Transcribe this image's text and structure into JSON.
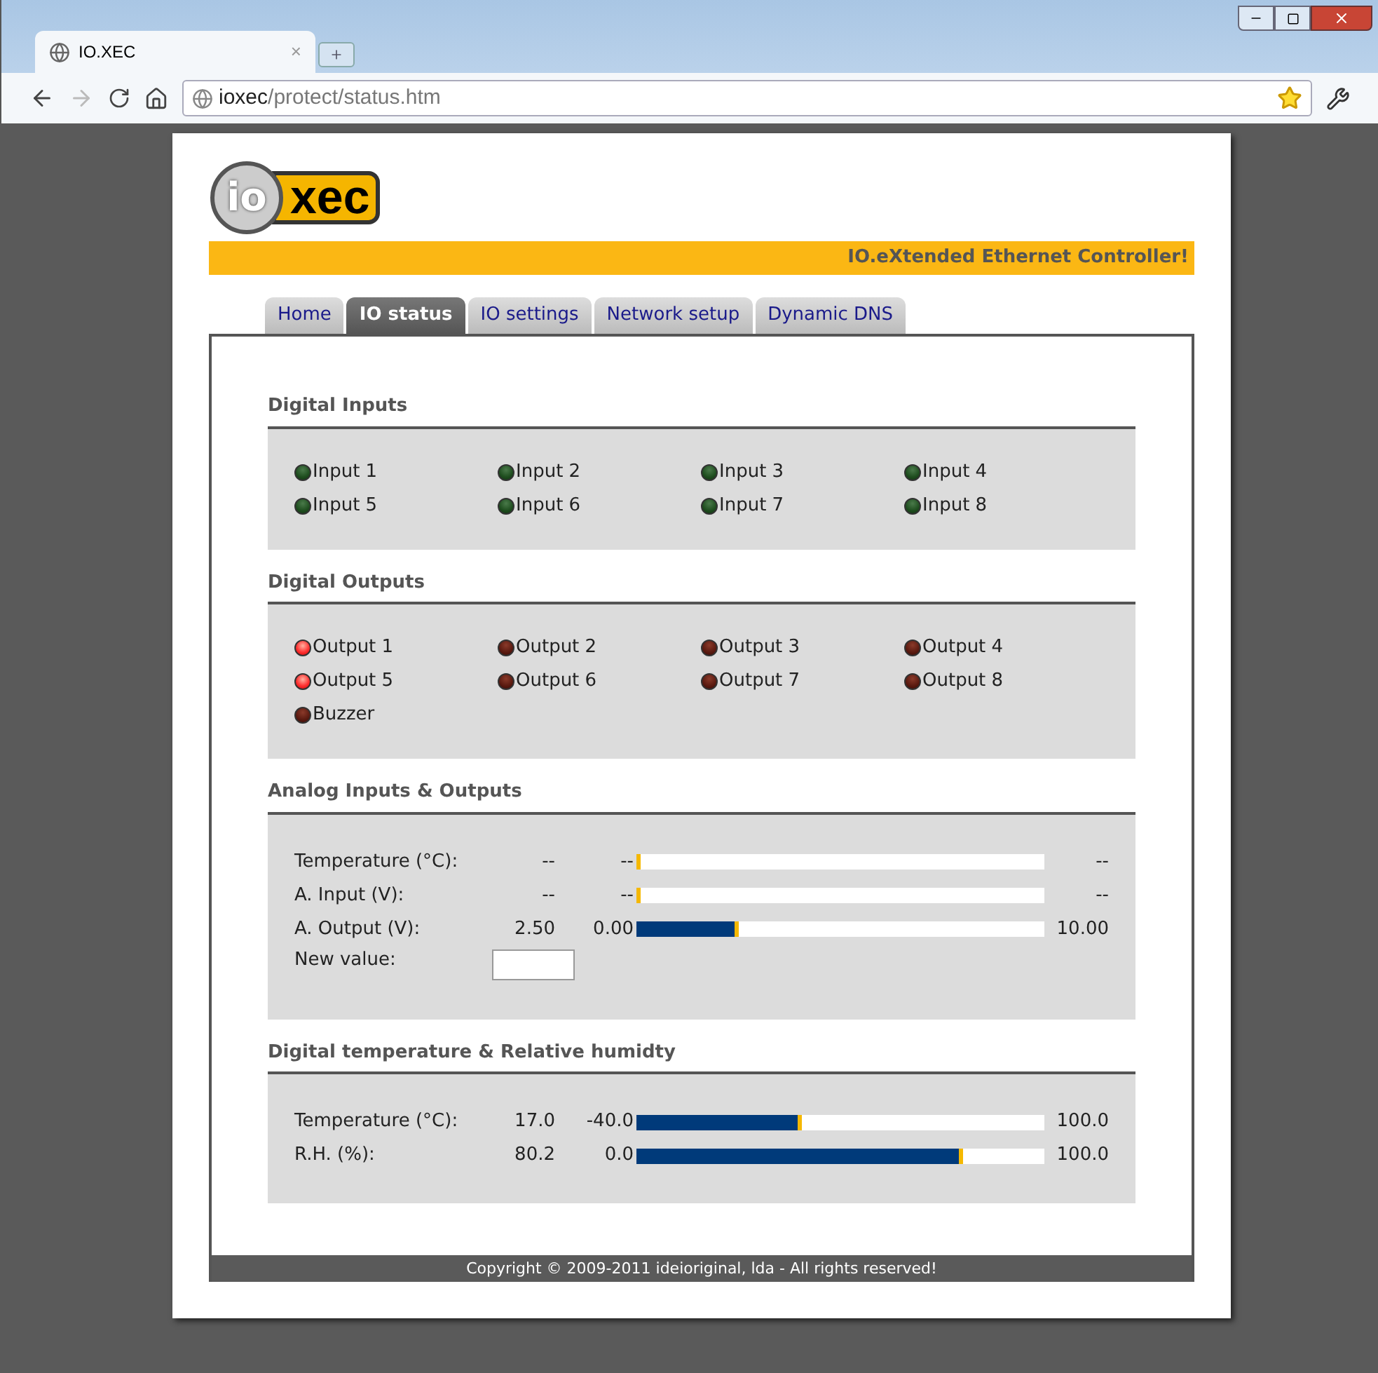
{
  "browser": {
    "tab_title": "IO.XEC",
    "tab_close": "×",
    "url_host": "ioxec",
    "url_path": "/protect/status.htm"
  },
  "logo": {
    "left": "io",
    "right": "xec"
  },
  "banner": "IO.eXtended Ethernet Controller!",
  "tabs": [
    {
      "label": "Home",
      "selected": false
    },
    {
      "label": "IO status",
      "selected": true
    },
    {
      "label": "IO settings",
      "selected": false
    },
    {
      "label": "Network setup",
      "selected": false
    },
    {
      "label": "Dynamic DNS",
      "selected": false
    }
  ],
  "digital_inputs": {
    "title": "Digital Inputs",
    "items": [
      {
        "label": "Input 1",
        "on": false
      },
      {
        "label": "Input 2",
        "on": false
      },
      {
        "label": "Input 3",
        "on": false
      },
      {
        "label": "Input 4",
        "on": false
      },
      {
        "label": "Input 5",
        "on": false
      },
      {
        "label": "Input 6",
        "on": false
      },
      {
        "label": "Input 7",
        "on": false
      },
      {
        "label": "Input 8",
        "on": false
      }
    ]
  },
  "digital_outputs": {
    "title": "Digital Outputs",
    "items": [
      {
        "label": "Output 1",
        "on": true
      },
      {
        "label": "Output 2",
        "on": false
      },
      {
        "label": "Output 3",
        "on": false
      },
      {
        "label": "Output 4",
        "on": false
      },
      {
        "label": "Output 5",
        "on": true
      },
      {
        "label": "Output 6",
        "on": false
      },
      {
        "label": "Output 7",
        "on": false
      },
      {
        "label": "Output 8",
        "on": false
      },
      {
        "label": "Buzzer",
        "on": false
      }
    ]
  },
  "analog": {
    "title": "Analog Inputs & Outputs",
    "rows": [
      {
        "label": "Temperature (°C):",
        "value": "--",
        "min": "--",
        "max": "--",
        "level": 0
      },
      {
        "label": "A. Input (V):",
        "value": "--",
        "min": "--",
        "max": "--",
        "level": 0
      },
      {
        "label": "A. Output (V):",
        "value": "2.50",
        "min": "0.00",
        "max": "10.00",
        "level": 0.25
      }
    ],
    "new_value_label": "New value:"
  },
  "digital_temp": {
    "title": "Digital temperature & Relative humidty",
    "rows": [
      {
        "label": "Temperature (°C):",
        "value": "17.0",
        "min": "-40.0",
        "max": "100.0",
        "level": 0.407
      },
      {
        "label": "R.H. (%):",
        "value": "80.2",
        "min": "0.0",
        "max": "100.0",
        "level": 0.802
      }
    ]
  },
  "footer": "Copyright © 2009-2011 ideioriginal, lda - All rights reserved!"
}
